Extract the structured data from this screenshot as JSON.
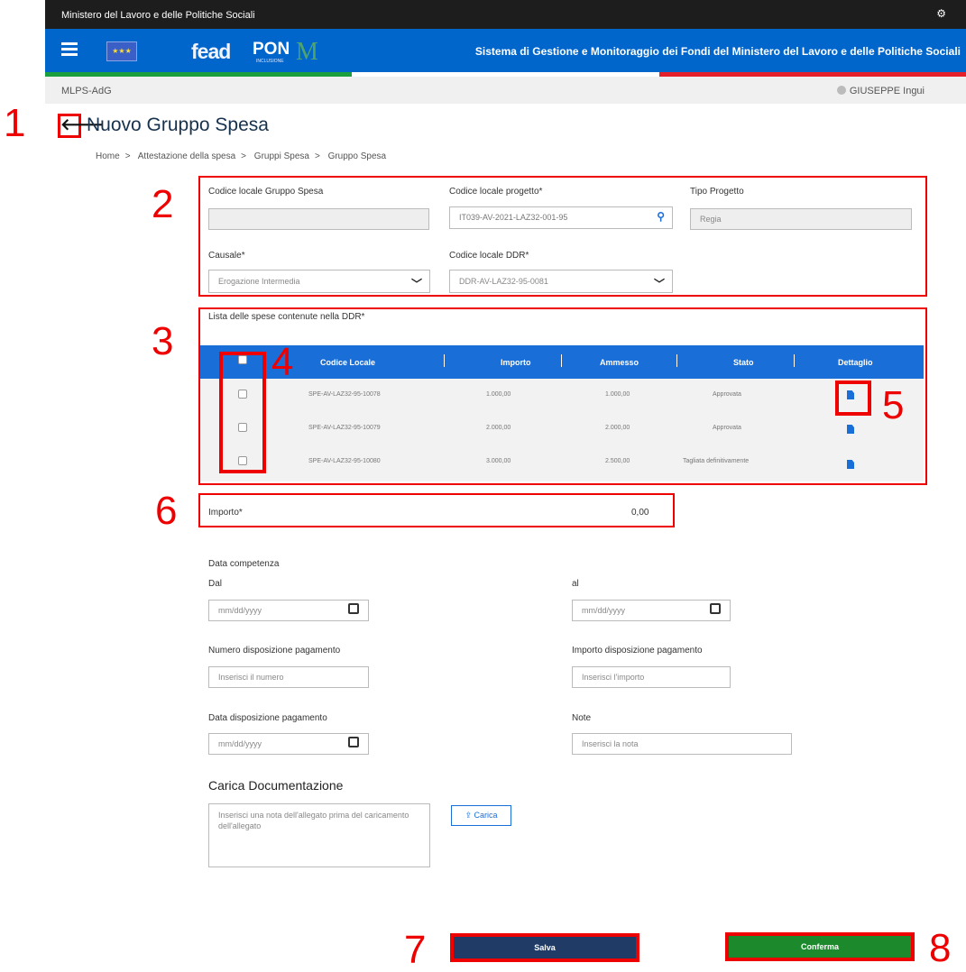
{
  "topbar": {
    "ministry": "Ministero del Lavoro e delle Politiche Sociali",
    "settings_icon": "gear-icon"
  },
  "header": {
    "logo_fead": "fead",
    "logo_pon": "PON",
    "logo_pon_sub": "INCLUSIONE",
    "app_title": "Sistema di Gestione e Monitoraggio dei Fondi del Ministero del Lavoro e delle Politiche Sociali",
    "flag_colors": [
      "#1b9e3e",
      "#ffffff",
      "#e4202a"
    ]
  },
  "subbar": {
    "org": "MLPS-AdG",
    "user": "GIUSEPPE Ingui"
  },
  "page": {
    "title": "Nuovo Gruppo Spesa",
    "back_icon": "arrow-left-icon"
  },
  "breadcrumb": [
    "Home",
    ">",
    "Attestazione della spesa",
    ">",
    "Gruppi Spesa",
    ">",
    "Gruppo Spesa"
  ],
  "callouts": [
    "1",
    "2",
    "3",
    "4",
    "5",
    "6",
    "7",
    "8"
  ],
  "form": {
    "codice_gruppo_label": "Codice locale Gruppo Spesa",
    "codice_gruppo_value": "",
    "codice_progetto_label": "Codice locale progetto*",
    "codice_progetto_value": "IT039-AV-2021-LAZ32-001-95",
    "tipo_progetto_label": "Tipo Progetto",
    "tipo_progetto_value": "Regia",
    "causale_label": "Causale*",
    "causale_value": "Erogazione Intermedia",
    "ddr_label": "Codice locale DDR*",
    "ddr_value": "DDR-AV-LAZ32-95-0081"
  },
  "spese": {
    "label": "Lista delle spese contenute nella DDR*",
    "columns": [
      "Codice Locale",
      "Importo",
      "Ammesso",
      "Stato",
      "Dettaglio"
    ],
    "rows": [
      {
        "codice": "SPE-AV-LAZ32-95-10078",
        "importo": "1.000,00",
        "ammesso": "1.000,00",
        "stato": "Approvata"
      },
      {
        "codice": "SPE-AV-LAZ32-95-10079",
        "importo": "2.000,00",
        "ammesso": "2.000,00",
        "stato": "Approvata"
      },
      {
        "codice": "SPE-AV-LAZ32-95-10080",
        "importo": "3.000,00",
        "ammesso": "2.500,00",
        "stato": "Tagliata definitivamente"
      }
    ]
  },
  "importo": {
    "label": "Importo*",
    "value": "0,00"
  },
  "competenza": {
    "title": "Data competenza",
    "dal_label": "Dal",
    "dal_placeholder": "mm/dd/yyyy",
    "al_label": "al",
    "al_placeholder": "mm/dd/yyyy"
  },
  "pagamento": {
    "numero_label": "Numero disposizione pagamento",
    "numero_placeholder": "Inserisci il numero",
    "importo_label": "Importo disposizione pagamento",
    "importo_placeholder": "Inserisci l'importo",
    "data_label": "Data disposizione pagamento",
    "data_placeholder": "mm/dd/yyyy",
    "note_label": "Note",
    "note_placeholder": "Inserisci la nota"
  },
  "documentazione": {
    "title": "Carica Documentazione",
    "placeholder": "Inserisci una nota dell'allegato prima del caricamento dell'allegato",
    "carica_label": "Carica"
  },
  "actions": {
    "salva": "Salva",
    "conferma": "Conferma",
    "salva_color": "#1f3b66",
    "conferma_color": "#1c8a2c"
  }
}
